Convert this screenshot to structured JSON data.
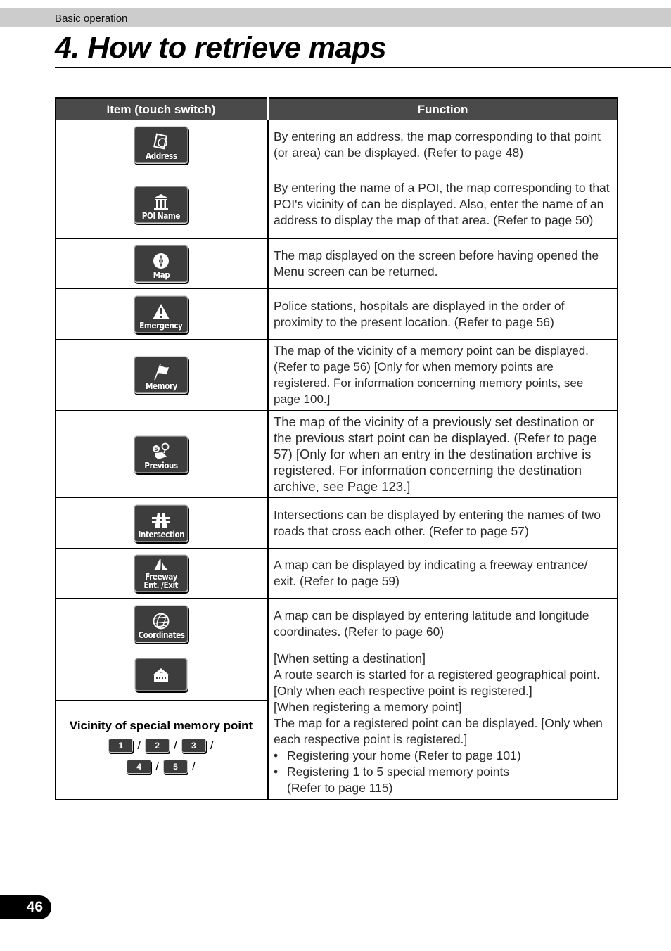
{
  "header": {
    "section": "Basic operation",
    "title": "4.  How to retrieve maps"
  },
  "table": {
    "columns": [
      "Item (touch switch)",
      "Function"
    ],
    "rows": [
      {
        "icon": "address-book-icon",
        "label": "Address",
        "function": "By entering an address, the map corresponding to that point (or area) can be displayed.  (Refer to page 48)"
      },
      {
        "icon": "poi-building-icon",
        "label": "POI Name",
        "function": "By entering the name of a POI, the map corresponding to that POI's vicinity of can be displayed.  Also, enter the name of an address to display the map of that area.  (Refer to page 50)"
      },
      {
        "icon": "compass-icon",
        "label": "Map",
        "function": "The map displayed on the screen before having opened the Menu screen can be returned."
      },
      {
        "icon": "warning-icon",
        "label": "Emergency",
        "function": "Police stations, hospitals are displayed in the order of proximity to the present location.  (Refer to page 56)"
      },
      {
        "icon": "flag-icon",
        "label": "Memory",
        "function": "The map of the vicinity of a memory point can be displayed.  (Refer to page 56) [Only for when memory points are registered.  For information concerning memory points, see page 100.]"
      },
      {
        "icon": "previous-destination-icon",
        "label": "Previous",
        "function": "The map of the vicinity of a previously set destination or the previous start point can be displayed.  (Refer to page 57) [Only for when an entry in the destination archive is registered.  For information concerning the destination archive, see Page 123.]"
      },
      {
        "icon": "intersection-icon",
        "label": "Intersection",
        "function": "Intersections can be displayed by entering the names of two roads that cross each other.  (Refer to page 57)"
      },
      {
        "icon": "freeway-icon",
        "label_line1": "Freeway",
        "label_line2": "Ent. /Exit",
        "function": "A map can be displayed by indicating a freeway entrance/ exit.  (Refer to page 59)"
      },
      {
        "icon": "globe-icon",
        "label": "Coordinates",
        "function": "A map can be displayed by entering latitude and longitude coordinates.  (Refer to page 60)"
      }
    ],
    "special": {
      "home_icon": "home-icon",
      "vicinity_title": "Vicinity of special memory point",
      "numbers_row1": [
        "1",
        "2",
        "3"
      ],
      "numbers_row2": [
        "4",
        "5"
      ],
      "separator": "/",
      "function_lines": [
        "[When setting a destination]",
        "A route search is started for a registered geographical point.  [Only when each respective point is registered.]",
        "[When registering a memory point]",
        "The map for a registered point can be displayed.  [Only when each respective point is registered.]"
      ],
      "bullets": [
        "Registering your home (Refer to page 101)",
        "Registering 1 to 5 special memory points (Refer to page 115)"
      ],
      "bullet_char": "•"
    }
  },
  "footer": {
    "page_number": "46"
  }
}
